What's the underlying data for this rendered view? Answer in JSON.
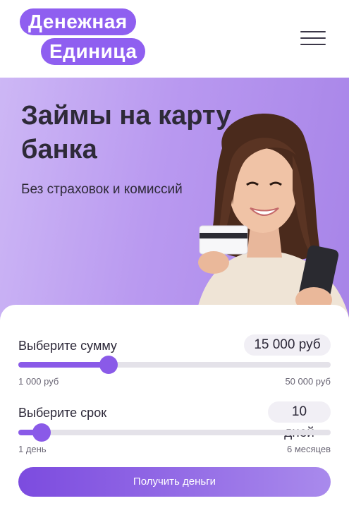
{
  "header": {
    "logo_line1": "Денежная",
    "logo_line2": "Единица",
    "menu_icon": "hamburger-menu-icon"
  },
  "hero": {
    "title": "Займы на карту банка",
    "subtitle": "Без страховок и комиссий"
  },
  "calculator": {
    "amount": {
      "label": "Выберите сумму",
      "value": "15 000 руб",
      "min_label": "1 000 руб",
      "max_label": "50 000 руб",
      "slider_fraction": 0.29
    },
    "term": {
      "label": "Выберите срок",
      "value": "10 дней",
      "min_label": "1 день",
      "max_label": "6 месяцев",
      "slider_fraction": 0.075
    },
    "submit_label": "Получить деньги"
  },
  "colors": {
    "brand_purple": "#8a5ae8",
    "hero_bg": "#b999f0"
  }
}
